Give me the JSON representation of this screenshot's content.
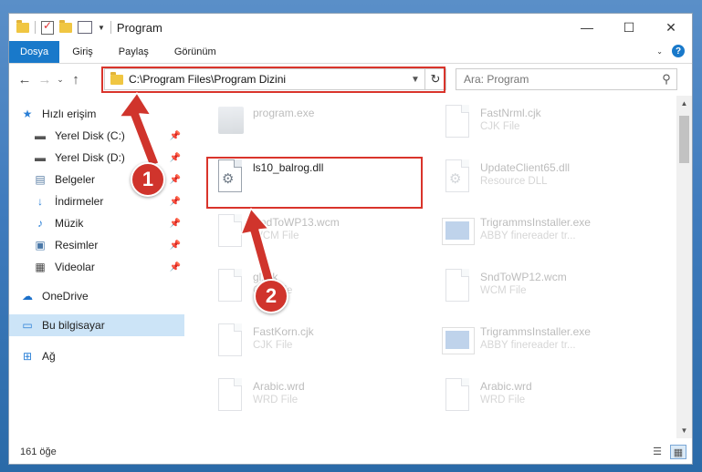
{
  "window": {
    "title": "Program",
    "controls": {
      "minimize": "—",
      "maximize": "☐",
      "close": "✕"
    }
  },
  "ribbon": {
    "tabs": [
      "Dosya",
      "Giriş",
      "Paylaş",
      "Görünüm"
    ],
    "help": "?"
  },
  "navigation": {
    "address": "C:\\Program Files\\Program Dizini",
    "search_placeholder": "Ara: Program"
  },
  "sidebar": {
    "items": [
      {
        "label": "Hızlı erişim",
        "icon": "star-icon"
      },
      {
        "label": "Yerel Disk (C:)",
        "icon": "drive-icon",
        "pinned": true
      },
      {
        "label": "Yerel Disk (D:)",
        "icon": "drive-icon",
        "pinned": true
      },
      {
        "label": "Belgeler",
        "icon": "documents-icon",
        "pinned": true
      },
      {
        "label": "İndirmeler",
        "icon": "downloads-icon",
        "pinned": true
      },
      {
        "label": "Müzik",
        "icon": "music-icon",
        "pinned": true
      },
      {
        "label": "Resimler",
        "icon": "pictures-icon",
        "pinned": true
      },
      {
        "label": "Videolar",
        "icon": "videos-icon",
        "pinned": true
      },
      {
        "label": "OneDrive",
        "icon": "cloud-icon"
      },
      {
        "label": "Bu bilgisayar",
        "icon": "computer-icon",
        "selected": true
      },
      {
        "label": "Ağ",
        "icon": "network-icon"
      }
    ]
  },
  "files": [
    {
      "name": "program.exe",
      "type": "",
      "icon": "exe-icon",
      "faded": true
    },
    {
      "name": "FastNrml.cjk",
      "type": "CJK File",
      "icon": "document-icon",
      "faded": true
    },
    {
      "name": "ls10_balrog.dll",
      "type": "",
      "icon": "dll-gear-icon",
      "faded": false,
      "highlighted": true
    },
    {
      "name": "UpdateClient65.dll",
      "type": "Resource DLL",
      "icon": "dll-gear-icon",
      "faded": true
    },
    {
      "name": "SndToWP13.wcm",
      "type": "WCM File",
      "icon": "document-icon",
      "faded": true
    },
    {
      "name": "TrigrammsInstaller.exe",
      "type": "ABBY finereader tr...",
      "icon": "abby-icon",
      "faded": true
    },
    {
      "name": "gl.cjk",
      "type": "CJK File",
      "icon": "document-icon",
      "faded": true
    },
    {
      "name": "SndToWP12.wcm",
      "type": "WCM File",
      "icon": "document-icon",
      "faded": true
    },
    {
      "name": "FastKorn.cjk",
      "type": "CJK File",
      "icon": "document-icon",
      "faded": true
    },
    {
      "name": "TrigrammsInstaller.exe",
      "type": "ABBY finereader tr...",
      "icon": "abby-icon",
      "faded": true
    },
    {
      "name": "Arabic.wrd",
      "type": "WRD File",
      "icon": "document-icon",
      "faded": true
    },
    {
      "name": "Arabic.wrd",
      "type": "WRD File",
      "icon": "document-icon",
      "faded": true
    }
  ],
  "status": {
    "item_count": "161 öğe"
  },
  "callouts": {
    "one": "1",
    "two": "2"
  },
  "colors": {
    "highlight": "#d9342b",
    "callout": "#d0342c",
    "accent": "#1979ca"
  }
}
